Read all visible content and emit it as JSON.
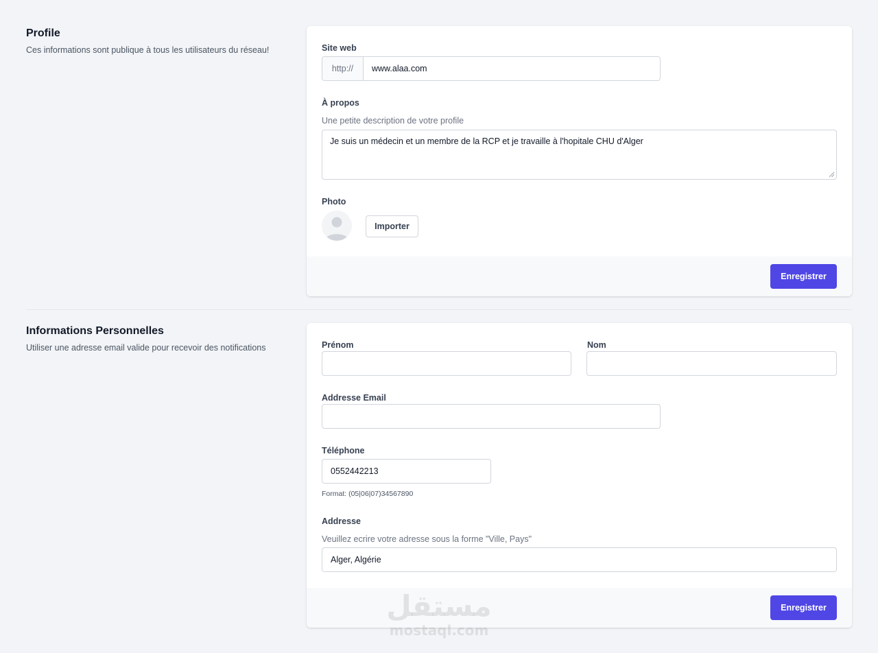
{
  "profile": {
    "title": "Profile",
    "description": "Ces informations sont publique à tous les utilisateurs du réseau!",
    "website": {
      "label": "Site web",
      "prefix": "http://",
      "value": "www.alaa.com"
    },
    "about": {
      "label": "À propos",
      "hint": "Une petite description de votre profile",
      "value": "Je suis un médecin et un membre de la RCP et je travaille à l'hopitale CHU d'Alger"
    },
    "photo": {
      "label": "Photo",
      "import_label": "Importer"
    },
    "save_label": "Enregistrer"
  },
  "personal": {
    "title": "Informations Personnelles",
    "description": "Utiliser une adresse email valide pour recevoir des notifications",
    "first_name": {
      "label": "Prénom",
      "value": ""
    },
    "last_name": {
      "label": "Nom",
      "value": ""
    },
    "email": {
      "label": "Addresse Email",
      "value": ""
    },
    "phone": {
      "label": "Téléphone",
      "value": "0552442213",
      "format_hint": "Format: (05|06|07)34567890"
    },
    "address": {
      "label": "Addresse",
      "hint": "Veuillez ecrire votre adresse sous la forme \"Ville, Pays\"",
      "value": "Alger, Algérie"
    },
    "save_label": "Enregistrer"
  },
  "watermark": {
    "arabic": "مستقل",
    "latin": "mostaql.com"
  },
  "colors": {
    "primary": "#4f46e5",
    "background": "#f2f4f7"
  }
}
